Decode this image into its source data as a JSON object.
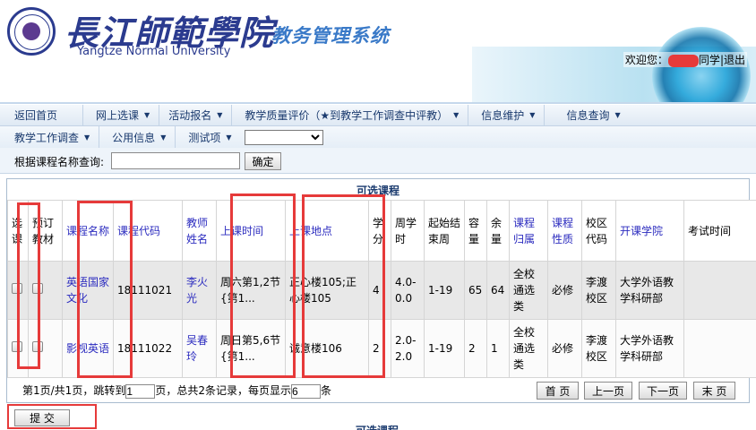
{
  "header": {
    "logo_cn": "長江師範學院",
    "logo_en": "Yangtze Normal University",
    "system_title": "教务管理系统",
    "welcome_prefix": "欢迎您：",
    "welcome_suffix": "同学",
    "separator": "|",
    "logout": "退出"
  },
  "nav": {
    "row1": [
      {
        "label": "返回首页",
        "dropdown": false
      },
      {
        "label": "网上选课",
        "dropdown": true
      },
      {
        "label": "活动报名",
        "dropdown": true
      },
      {
        "label": "教学质量评价（★到教学工作调查中评教）",
        "dropdown": true
      },
      {
        "label": "信息维护",
        "dropdown": true
      },
      {
        "label": "信息查询",
        "dropdown": true
      }
    ],
    "row2": [
      {
        "label": "教学工作调查",
        "dropdown": true
      },
      {
        "label": "公用信息",
        "dropdown": true
      },
      {
        "label": "测试项",
        "dropdown": true
      }
    ],
    "select_value": ""
  },
  "search": {
    "label": "根据课程名称查询:",
    "value": "",
    "button": "确定"
  },
  "table": {
    "title": "可选课程",
    "headers": [
      "选课",
      "预订教材",
      "课程名称",
      "课程代码",
      "教师姓名",
      "上课时间",
      "上课地点",
      "学分",
      "周学时",
      "起始结束周",
      "容量",
      "余量",
      "课程归属",
      "课程性质",
      "校区代码",
      "开课学院",
      "考试时间"
    ],
    "rows": [
      {
        "name": "英语国家文化",
        "code": "18111021",
        "teacher": "李火光",
        "time": "周六第1,2节{第1...",
        "place": "正心楼105;正心楼105",
        "credit": "4",
        "hours": "4.0-0.0",
        "weeks": "1-19",
        "capacity": "65",
        "remaining": "64",
        "belong": "全校通选类",
        "nature": "必修",
        "campus": "李渡校区",
        "college": "大学外语教学科研部",
        "exam": ""
      },
      {
        "name": "影视英语",
        "code": "18111022",
        "teacher": "吴春玲",
        "time": "周日第5,6节{第1...",
        "place": "诚意楼106",
        "credit": "2",
        "hours": "2.0-2.0",
        "weeks": "1-19",
        "capacity": "2",
        "remaining": "1",
        "belong": "全校通选类",
        "nature": "必修",
        "campus": "李渡校区",
        "college": "大学外语教学科研部",
        "exam": ""
      }
    ]
  },
  "pager": {
    "text1": "第1页/共1页，跳转到",
    "page_value": "1",
    "text2": "页，总共2条记录，每页显示",
    "size_value": "6",
    "text3": "条",
    "first": "首 页",
    "prev": "上一页",
    "next": "下一页",
    "last": "末 页"
  },
  "submit": "提 交",
  "bottom_title": "可选课程",
  "colors": {
    "brand": "#2b3b8f",
    "title_blue": "#3a7ac8",
    "link": "#2b2bbf",
    "highlight": "#e63a3a"
  }
}
